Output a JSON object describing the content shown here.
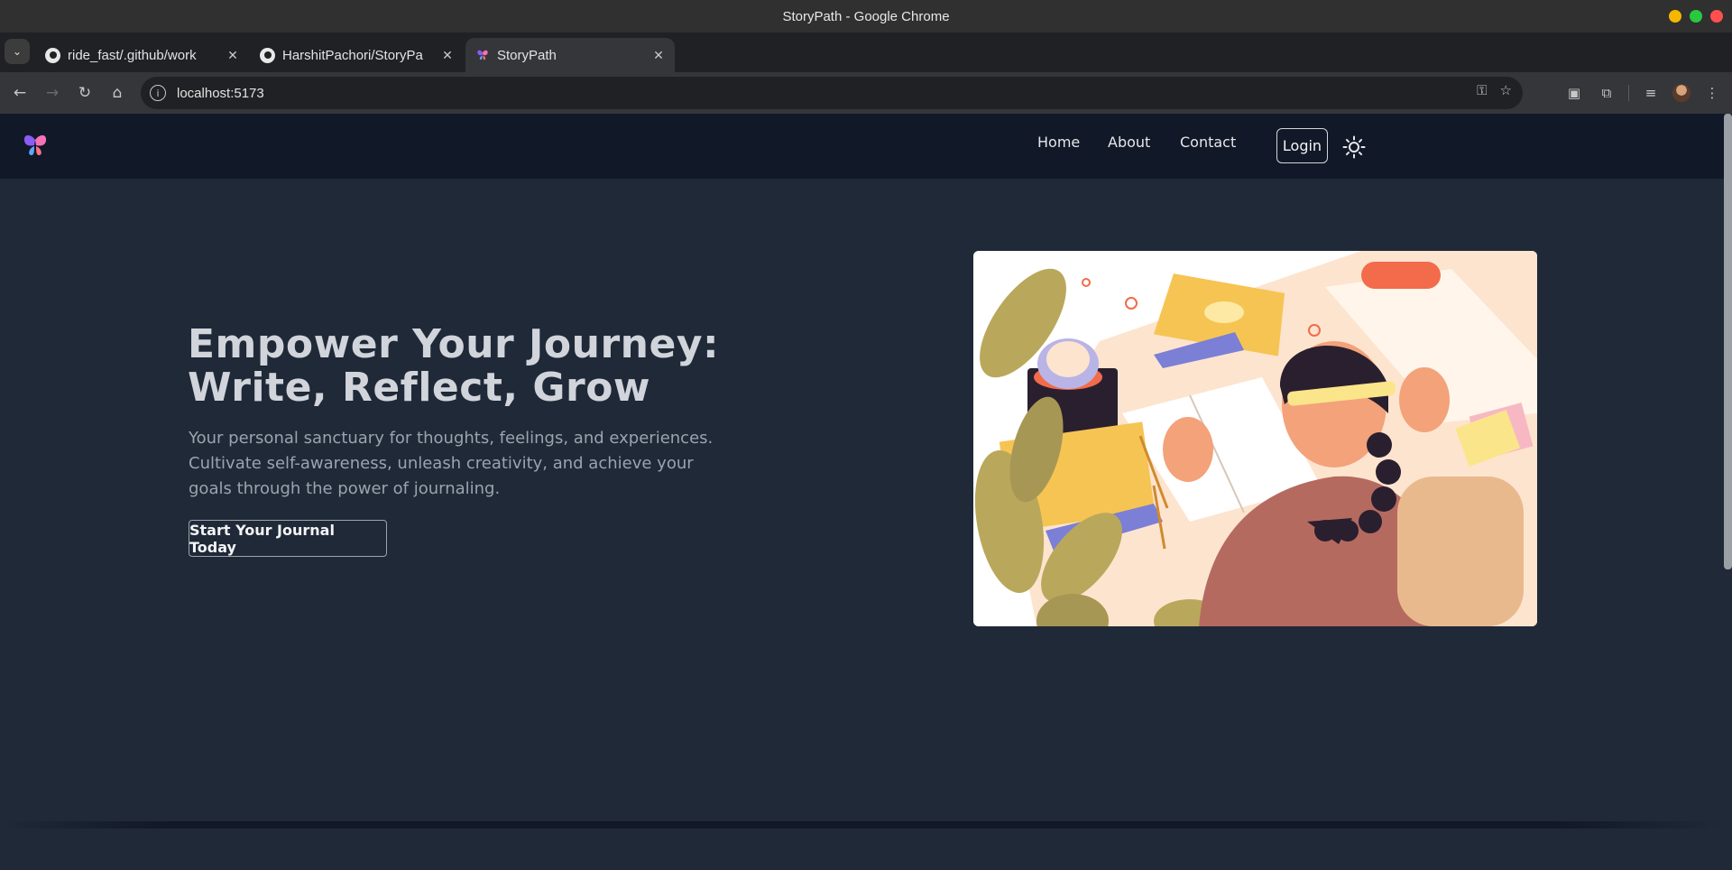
{
  "browser": {
    "window_title": "StoryPath - Google Chrome",
    "tabs": [
      {
        "label": "ride_fast/.github/work",
        "active": false
      },
      {
        "label": "HarshitPachori/StoryPa",
        "active": false
      },
      {
        "label": "StoryPath",
        "active": true
      }
    ],
    "url": "localhost:5173"
  },
  "nav": {
    "links": [
      "Home",
      "About",
      "Contact"
    ],
    "login_label": "Login"
  },
  "hero": {
    "title_line1": "Empower Your Journey:",
    "title_line2": "Write, Reflect, Grow",
    "subtitle": "Your personal sanctuary for thoughts, feelings, and experiences. Cultivate self-awareness, unleash creativity, and achieve your goals through the power of journaling.",
    "cta_label": "Start Your Journal Today"
  },
  "colors": {
    "page_bg": "#1f2937",
    "navbar_bg": "#111827",
    "title_text": "#d1d5db",
    "body_text": "#9ca3af"
  },
  "icons": [
    "back-icon",
    "forward-icon",
    "reload-icon",
    "home-icon",
    "site-info-icon",
    "key-icon",
    "star-icon",
    "sidepanel-icon",
    "extensions-icon",
    "media-icon",
    "menu-icon",
    "butterfly-logo",
    "sun-icon"
  ]
}
